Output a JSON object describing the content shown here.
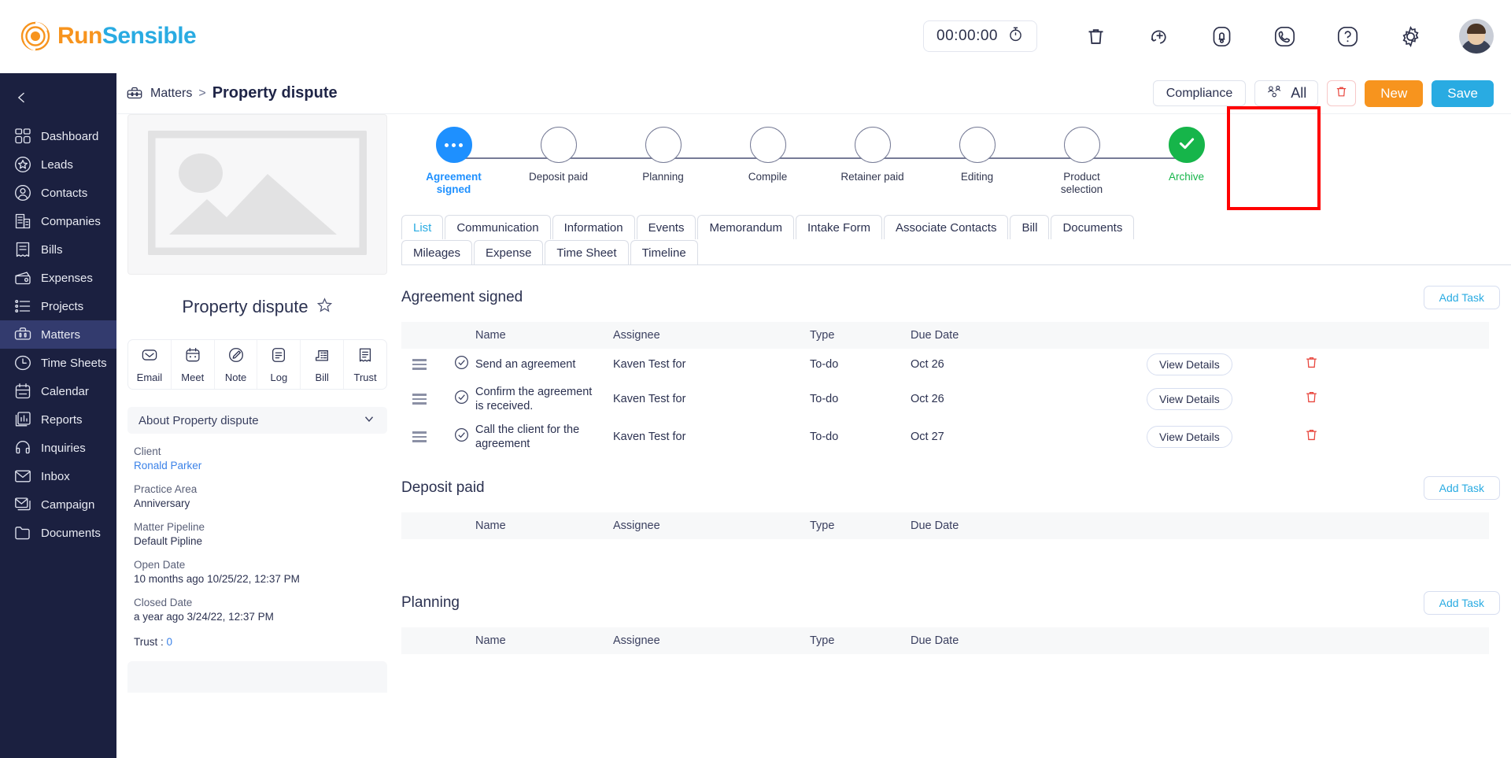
{
  "brand": {
    "run": "Run",
    "sensible": "Sensible",
    "logo_icon": "spiral-logo-icon"
  },
  "header": {
    "timer": "00:00:00",
    "icons": [
      "stopwatch-icon",
      "trash-icon",
      "add-circle-icon",
      "notification-bell-icon",
      "phone-icon",
      "help-icon",
      "settings-gear-icon",
      "user-avatar"
    ]
  },
  "sidebar": {
    "collapse_icon": "chevron-left-icon",
    "items": [
      {
        "label": "Dashboard",
        "icon": "dashboard-icon",
        "active": false
      },
      {
        "label": "Leads",
        "icon": "leads-star-icon",
        "active": false
      },
      {
        "label": "Contacts",
        "icon": "contacts-user-icon",
        "active": false
      },
      {
        "label": "Companies",
        "icon": "companies-building-icon",
        "active": false
      },
      {
        "label": "Bills",
        "icon": "bills-receipt-icon",
        "active": false
      },
      {
        "label": "Expenses",
        "icon": "expenses-wallet-icon",
        "active": false
      },
      {
        "label": "Projects",
        "icon": "projects-list-icon",
        "active": false
      },
      {
        "label": "Matters",
        "icon": "matters-briefcase-icon",
        "active": true
      },
      {
        "label": "Time Sheets",
        "icon": "time-sheets-clock-icon",
        "active": false
      },
      {
        "label": "Calendar",
        "icon": "calendar-icon",
        "active": false
      },
      {
        "label": "Reports",
        "icon": "reports-chart-icon",
        "active": false
      },
      {
        "label": "Inquiries",
        "icon": "inquiries-headset-icon",
        "active": false
      },
      {
        "label": "Inbox",
        "icon": "inbox-envelope-icon",
        "active": false
      },
      {
        "label": "Campaign",
        "icon": "campaign-mail-stack-icon",
        "active": false
      },
      {
        "label": "Documents",
        "icon": "documents-folder-icon",
        "active": false
      }
    ]
  },
  "breadcrumb": {
    "icon": "matters-briefcase-icon",
    "parent": "Matters",
    "separator": ">",
    "current": "Property dispute"
  },
  "page_actions": {
    "compliance": "Compliance",
    "all": "All",
    "all_icon": "group-users-icon",
    "delete_icon": "trash-icon",
    "new": "New",
    "save": "Save",
    "new_color": "#F7941E",
    "save_color": "#29ABE2",
    "delete_color": "#e8453c"
  },
  "matter": {
    "image_placeholder_icon": "image-placeholder-icon",
    "title": "Property dispute",
    "favorite_icon": "star-outline-icon",
    "quick_actions": [
      {
        "label": "Email",
        "icon": "email-envelope-icon"
      },
      {
        "label": "Meet",
        "icon": "meet-calendar-icon"
      },
      {
        "label": "Note",
        "icon": "note-pencil-icon"
      },
      {
        "label": "Log",
        "icon": "log-document-icon"
      },
      {
        "label": "Bill",
        "icon": "bill-invoice-icon"
      },
      {
        "label": "Trust",
        "icon": "trust-receipt-icon"
      }
    ],
    "about_header": "About Property dispute",
    "about_chevron": "chevron-down-icon",
    "fields": [
      {
        "label": "Client",
        "value": "Ronald Parker",
        "is_link": true
      },
      {
        "label": "Practice Area",
        "value": "Anniversary",
        "is_link": false
      },
      {
        "label": "Matter Pipeline",
        "value": "Default Pipline",
        "is_link": false
      },
      {
        "label": "Open Date",
        "value": "10 months ago 10/25/22, 12:37 PM",
        "is_link": false
      },
      {
        "label": "Closed Date",
        "value": "a year ago 3/24/22, 12:37 PM",
        "is_link": false
      }
    ],
    "trust_label": "Trust :",
    "trust_value": "0"
  },
  "pipeline": {
    "current_color": "#1E90FF",
    "done_color": "#16b54a",
    "highlight_color": "#ff0000",
    "steps": [
      {
        "label": "Agreement signed",
        "state": "current",
        "icon": "dots-icon"
      },
      {
        "label": "Deposit paid",
        "state": "pending",
        "icon": ""
      },
      {
        "label": "Planning",
        "state": "pending",
        "icon": ""
      },
      {
        "label": "Compile",
        "state": "pending",
        "icon": ""
      },
      {
        "label": "Retainer paid",
        "state": "pending",
        "icon": ""
      },
      {
        "label": "Editing",
        "state": "pending",
        "icon": ""
      },
      {
        "label": "Product selection",
        "state": "pending",
        "icon": ""
      },
      {
        "label": "Archive",
        "state": "done",
        "icon": "check-icon"
      }
    ]
  },
  "tabs": {
    "row1": [
      {
        "label": "List",
        "active": true
      },
      {
        "label": "Communication",
        "active": false
      },
      {
        "label": "Information",
        "active": false
      },
      {
        "label": "Events",
        "active": false
      },
      {
        "label": "Memorandum",
        "active": false
      },
      {
        "label": "Intake Form",
        "active": false
      },
      {
        "label": "Associate Contacts",
        "active": false
      },
      {
        "label": "Bill",
        "active": false
      },
      {
        "label": "Documents",
        "active": false
      }
    ],
    "row2": [
      {
        "label": "Mileages",
        "active": false
      },
      {
        "label": "Expense",
        "active": false
      },
      {
        "label": "Time Sheet",
        "active": false
      },
      {
        "label": "Timeline",
        "active": false
      }
    ]
  },
  "task_table": {
    "columns": [
      "Name",
      "Assignee",
      "Type",
      "Due Date"
    ],
    "add_task_label": "Add Task",
    "view_details_label": "View Details",
    "drag_icon": "drag-handle-icon",
    "check_icon": "check-circle-icon",
    "delete_icon": "trash-icon"
  },
  "sections": [
    {
      "title": "Agreement signed",
      "rows": [
        {
          "name": "Send an agreement",
          "assignee": "Kaven Test for",
          "type": "To-do",
          "due": "Oct 26"
        },
        {
          "name": "Confirm the agreement is received.",
          "assignee": "Kaven Test for",
          "type": "To-do",
          "due": "Oct 26"
        },
        {
          "name": "Call the client for the agreement",
          "assignee": "Kaven Test for",
          "type": "To-do",
          "due": "Oct 27"
        }
      ]
    },
    {
      "title": "Deposit paid",
      "rows": []
    },
    {
      "title": "Planning",
      "rows": []
    }
  ]
}
